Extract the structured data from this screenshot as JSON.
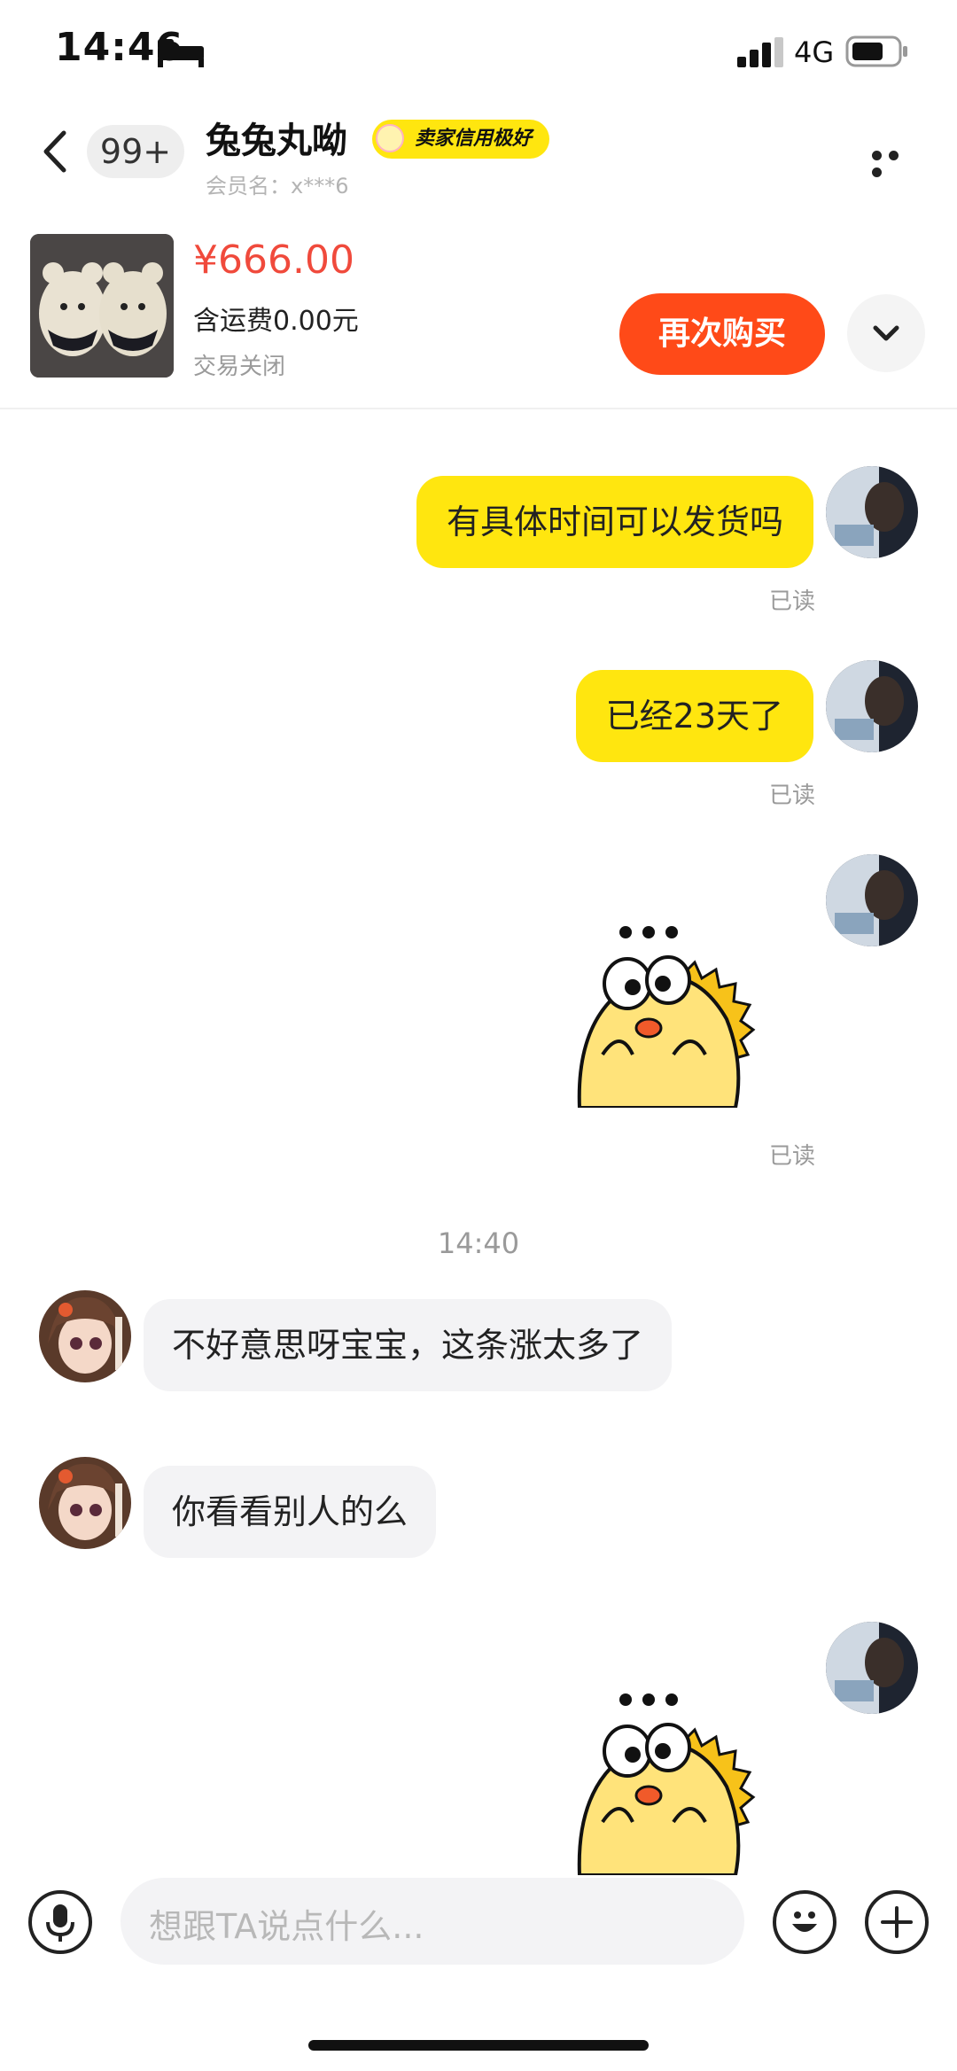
{
  "status_bar": {
    "time": "14:46",
    "network": "4G"
  },
  "header": {
    "unread_count": "99+",
    "seller_name": "兔兔丸呦",
    "credit_badge": "卖家信用极好",
    "member_label": "会员名：",
    "member_value": "x***6"
  },
  "product": {
    "price": "¥666.00",
    "shipping": "含运费0.00元",
    "status": "交易关闭",
    "buy_again": "再次购买"
  },
  "messages": [
    {
      "side": "me",
      "text": "有具体时间可以发货吗",
      "read": "已读"
    },
    {
      "side": "me",
      "text": "已经23天了",
      "read": "已读"
    },
    {
      "side": "me",
      "sticker": "thinking-dinosaur-sticker",
      "read": "已读"
    },
    {
      "time_separator": "14:40"
    },
    {
      "side": "them",
      "text": "不好意思呀宝宝，这条涨太多了"
    },
    {
      "side": "them",
      "text": "你看看别人的么"
    },
    {
      "side": "me",
      "sticker": "thinking-dinosaur-sticker"
    }
  ],
  "input": {
    "placeholder": "想跟TA说点什么..."
  },
  "colors": {
    "accent_yellow": "#ffe60f",
    "buy_orange": "#ff4a18",
    "price_red": "#f04a3c"
  }
}
